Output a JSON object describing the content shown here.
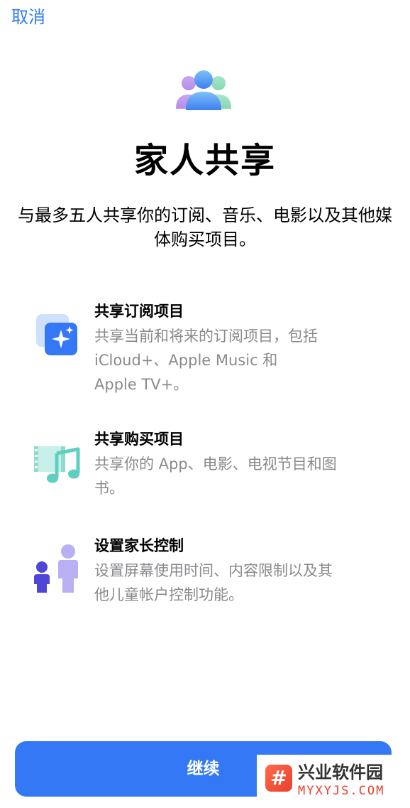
{
  "nav": {
    "cancel_label": "取消"
  },
  "hero": {
    "icon": "family-sharing-icon",
    "title": "家人共享",
    "subtitle": "与最多五人共享你的订阅、音乐、电影以及其他媒体购买项目。"
  },
  "features": [
    {
      "icon": "subscriptions-icon",
      "title": "共享订阅项目",
      "description": "共享当前和将来的订阅项目，包括\niCloud+、Apple Music 和\nApple TV+。"
    },
    {
      "icon": "purchases-icon",
      "title": "共享购买项目",
      "description": "共享你的 App、电影、电视节目和图\n书。"
    },
    {
      "icon": "parental-controls-icon",
      "title": "设置家长控制",
      "description": "设置屏幕使用时间、内容限制以及其\n他儿童帐户控制功能。"
    }
  ],
  "footer": {
    "continue_label": "继续"
  },
  "watermark": {
    "logo_glyph": "#",
    "name": "兴业软件园",
    "url": "MYXYJS.COM"
  },
  "colors": {
    "accent": "#3478f6",
    "secondary_text": "#8a8a8e"
  }
}
